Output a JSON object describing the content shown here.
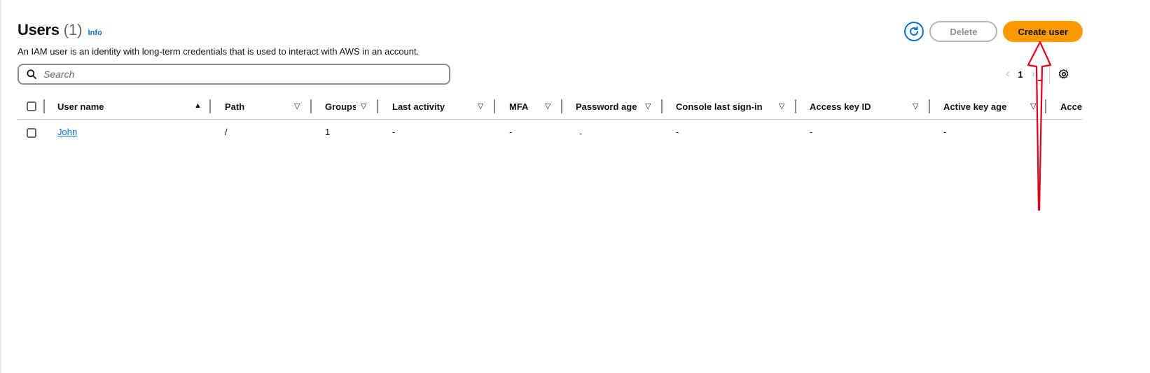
{
  "header": {
    "title": "Users",
    "count": "(1)",
    "info_label": "Info",
    "description": "An IAM user is an identity with long-term credentials that is used to interact with AWS in an account."
  },
  "actions": {
    "refresh_icon": "refresh-icon",
    "delete_label": "Delete",
    "create_label": "Create user",
    "accent_color": "#ff9900"
  },
  "search": {
    "placeholder": "Search",
    "value": ""
  },
  "pagination": {
    "current_page": "1",
    "prev_icon": "chevron-left-icon",
    "next_icon": "chevron-right-icon",
    "settings_icon": "gear-icon"
  },
  "table": {
    "columns": [
      {
        "label": "User name",
        "sort": "ascending"
      },
      {
        "label": "Path",
        "sort": "none"
      },
      {
        "label": "Groups",
        "sort": "none"
      },
      {
        "label": "Last activity",
        "sort": "none"
      },
      {
        "label": "MFA",
        "sort": "none"
      },
      {
        "label": "Password age",
        "sort": "none"
      },
      {
        "label": "Console last sign-in",
        "sort": "none"
      },
      {
        "label": "Access key ID",
        "sort": "none"
      },
      {
        "label": "Active key age",
        "sort": "none"
      },
      {
        "label": "Access",
        "sort": "none"
      }
    ],
    "rows": [
      {
        "user_name": "John",
        "path": "/",
        "groups": "1",
        "last_activity": "-",
        "mfa": "-",
        "password_age": "-",
        "console_last_sign_in": "-",
        "access_key_id": "-",
        "active_key_age": "-"
      }
    ]
  },
  "annotation": {
    "color": "#e0001b",
    "type": "red-arrow-pointing-to-create-user"
  }
}
